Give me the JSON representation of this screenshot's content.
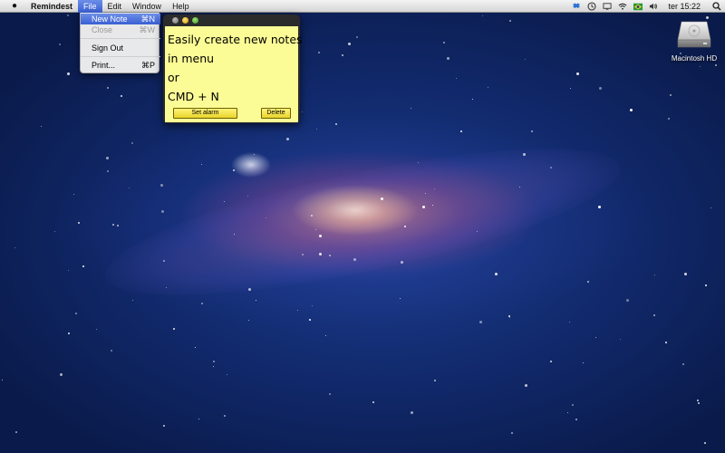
{
  "menubar": {
    "apple_icon": "apple-logo-icon",
    "app_name": "Remindest",
    "menus": [
      "File",
      "Edit",
      "Window",
      "Help"
    ],
    "active_menu": "File",
    "status_icons": [
      "dropbox-icon",
      "time-machine-icon",
      "display-icon",
      "wifi-icon",
      "flag-brazil-icon",
      "volume-icon"
    ],
    "clock": "ter 15:22",
    "spotlight_icon": "search-icon"
  },
  "file_menu": {
    "items": [
      {
        "label": "New Note",
        "shortcut": "⌘N",
        "state": "highlighted"
      },
      {
        "label": "Close",
        "shortcut": "⌘W",
        "state": "disabled"
      },
      {
        "label": "Sign Out",
        "shortcut": "",
        "state": "normal"
      },
      {
        "label": "Print...",
        "shortcut": "⌘P",
        "state": "normal"
      }
    ]
  },
  "note": {
    "lines": [
      "Easily create new notes",
      "in menu",
      "or",
      "CMD + N"
    ],
    "set_alarm_label": "Set alarm",
    "delete_label": "Delete",
    "background_color": "#fcfc96"
  },
  "desktop": {
    "drive_label": "Macintosh HD",
    "drive_icon": "hard-drive-icon"
  }
}
